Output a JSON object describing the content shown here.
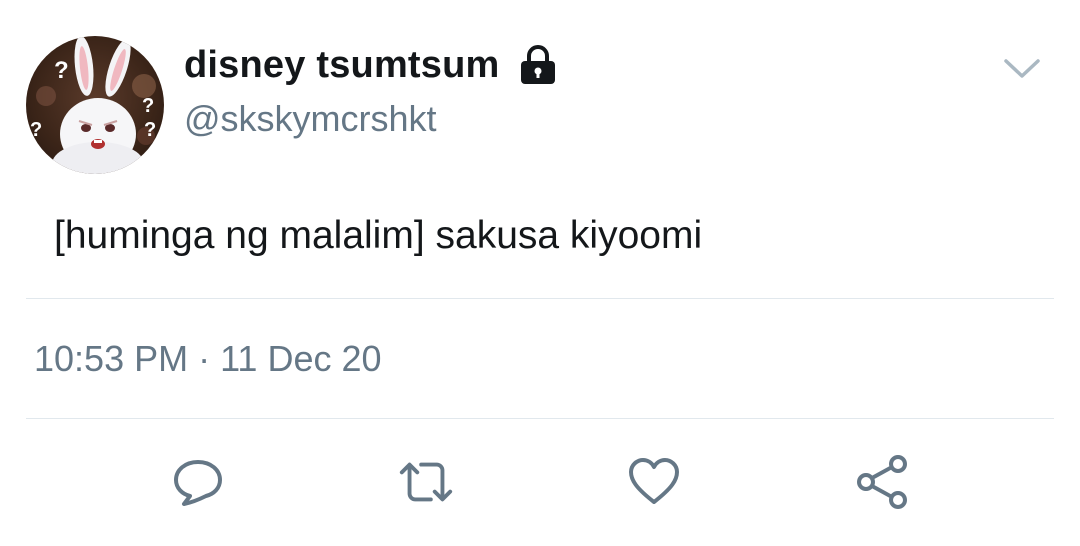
{
  "author": {
    "display_name": "disney tsumtsum",
    "handle": "@skskymcrshkt",
    "protected_icon": "lock-icon",
    "avatar": "white-rabbit-avatar"
  },
  "tweet": {
    "text": "[huminga ng malalim] sakusa kiyoomi",
    "timestamp": "10:53 PM · 11 Dec 20"
  },
  "actions": [
    {
      "name": "reply",
      "icon": "speech-bubble-icon"
    },
    {
      "name": "retweet",
      "icon": "retweet-arrows-icon"
    },
    {
      "name": "like",
      "icon": "heart-icon"
    },
    {
      "name": "share",
      "icon": "share-nodes-icon"
    }
  ],
  "menu_icon": "chevron-down-icon",
  "colors": {
    "text_primary": "#14171a",
    "text_secondary": "#657786",
    "divider": "#e1e8ed"
  }
}
